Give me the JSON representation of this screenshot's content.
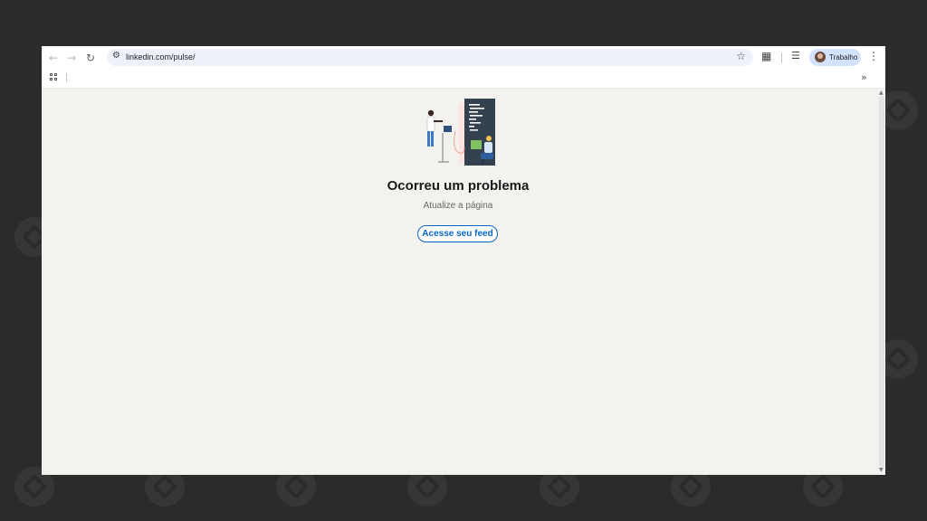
{
  "browser": {
    "url": "linkedin.com/pulse/",
    "profile_name": "Trabalho",
    "icons": {
      "back": "back-arrow-icon",
      "forward": "forward-arrow-icon",
      "reload": "reload-icon",
      "site_info": "tune-icon",
      "bookmark": "star-icon",
      "extensions": "puzzle-icon",
      "media": "media-control-icon",
      "menu": "kebab-menu-icon",
      "apps": "apps-grid-icon",
      "more_bookmarks": "double-chevron-icon"
    }
  },
  "page": {
    "error_title": "Ocorreu um problema",
    "error_subtitle": "Atualize a página",
    "feed_button_label": "Acesse seu feed"
  },
  "colors": {
    "page_background": "#f3f2ef",
    "linkedin_blue": "#0a66c2",
    "omnibox": "#edf2fa",
    "profile_chip": "#d3e3fd"
  }
}
